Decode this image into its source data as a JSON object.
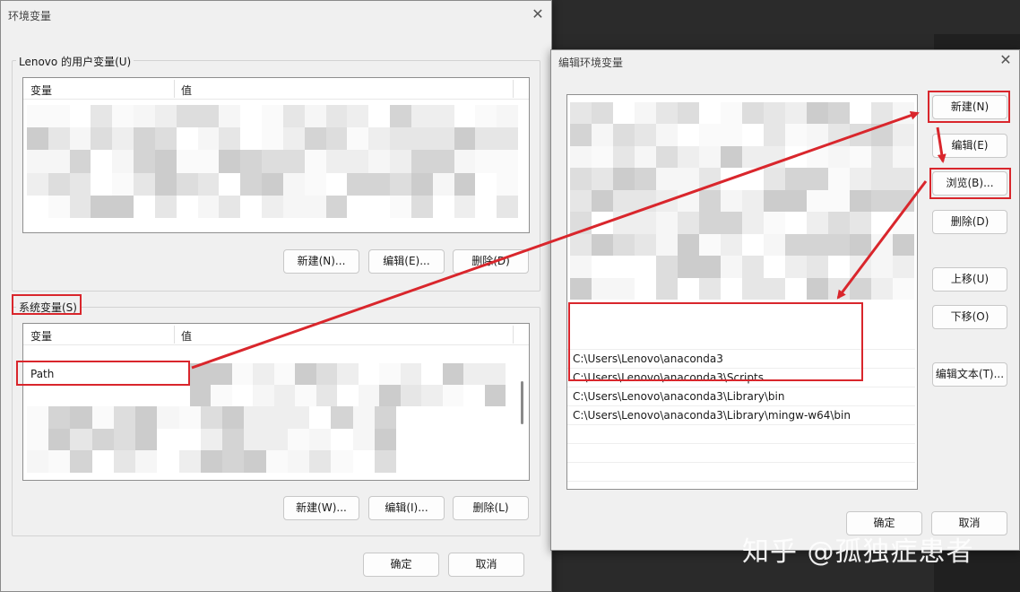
{
  "env_dialog": {
    "title": "环境变量",
    "user_group_label": "Lenovo 的用户变量(U)",
    "user_list_headers": [
      "变量",
      "值"
    ],
    "user_buttons": [
      "新建(N)...",
      "编辑(E)...",
      "删除(D)"
    ],
    "system_group_label": "系统变量(S)",
    "system_list_headers": [
      "变量",
      "值"
    ],
    "system_selected_var": "Path",
    "system_buttons": [
      "新建(W)...",
      "编辑(I)...",
      "删除(L)"
    ],
    "ok_label": "确定",
    "cancel_label": "取消"
  },
  "edit_dialog": {
    "title": "编辑环境变量",
    "path_entries": [
      "C:\\Users\\Lenovo\\anaconda3",
      "C:\\Users\\Lenovo\\anaconda3\\Scripts",
      "C:\\Users\\Lenovo\\anaconda3\\Library\\bin",
      "C:\\Users\\Lenovo\\anaconda3\\Library\\mingw-w64\\bin"
    ],
    "side_buttons": [
      "新建(N)",
      "编辑(E)",
      "浏览(B)...",
      "删除(D)",
      "上移(U)",
      "下移(O)",
      "编辑文本(T)..."
    ],
    "ok_label": "确定",
    "cancel_label": "取消"
  },
  "annotation_color": "#d9262c",
  "watermark": "知乎 @孤独症患者"
}
